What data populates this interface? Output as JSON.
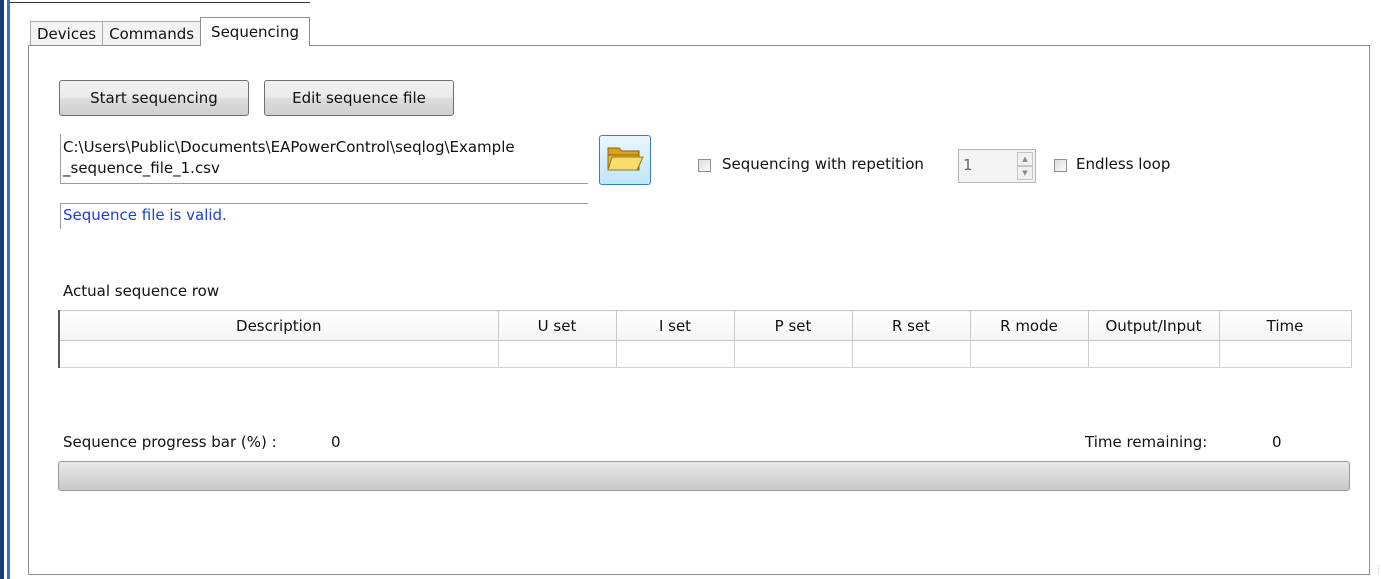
{
  "tabs": [
    {
      "label": "Devices"
    },
    {
      "label": "Commands"
    },
    {
      "label": "Sequencing"
    }
  ],
  "buttons": {
    "start": "Start sequencing",
    "edit": "Edit sequence file"
  },
  "file": {
    "path": "C:\\Users\\Public\\Documents\\EAPowerControl\\seqlog\\Example\n_sequence_file_1.csv",
    "status": "Sequence file is valid."
  },
  "options": {
    "repetition_label": "Sequencing with repetition",
    "repetition_value": "1",
    "endless_label": "Endless loop"
  },
  "sequence_table": {
    "title": "Actual sequence row",
    "columns": [
      "Description",
      "U set",
      "I set",
      "P set",
      "R set",
      "R mode",
      "Output/Input",
      "Time"
    ]
  },
  "progress": {
    "label": "Sequence progress bar (%) :",
    "value": "0",
    "time_label": "Time remaining:",
    "time_value": "0",
    "fraction": 0
  },
  "colors": {
    "status_text": "#1d3fd6",
    "panel_border": "#8e8e8e"
  },
  "icons": {
    "browse": "folder-open-icon"
  }
}
